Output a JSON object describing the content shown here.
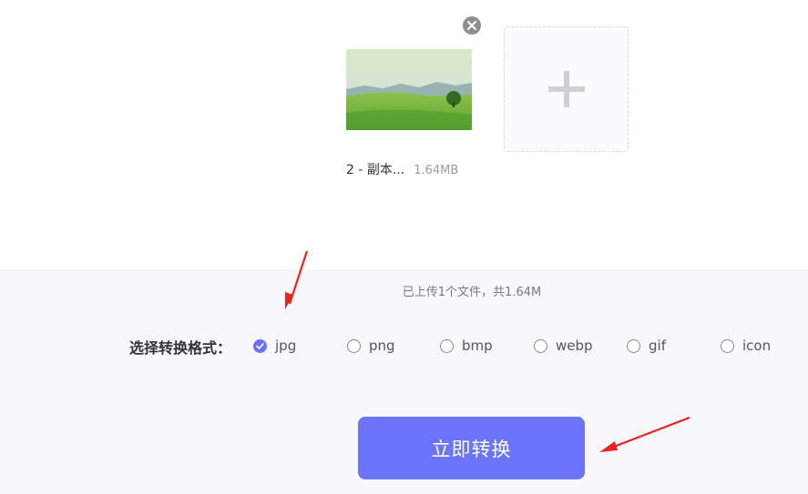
{
  "file": {
    "name": "2 - 副本...",
    "size": "1.64MB",
    "remove_icon": "close-icon"
  },
  "add_icon": "plus-icon",
  "summary": "已上传1个文件，共1.64M",
  "format": {
    "label": "选择转换格式：",
    "selected": "jpg",
    "options": [
      "jpg",
      "png",
      "bmp",
      "webp",
      "gif",
      "icon"
    ]
  },
  "convert_button": "立即转换",
  "colors": {
    "accent": "#6b74fa",
    "annotation_arrow": "#e8241f"
  }
}
